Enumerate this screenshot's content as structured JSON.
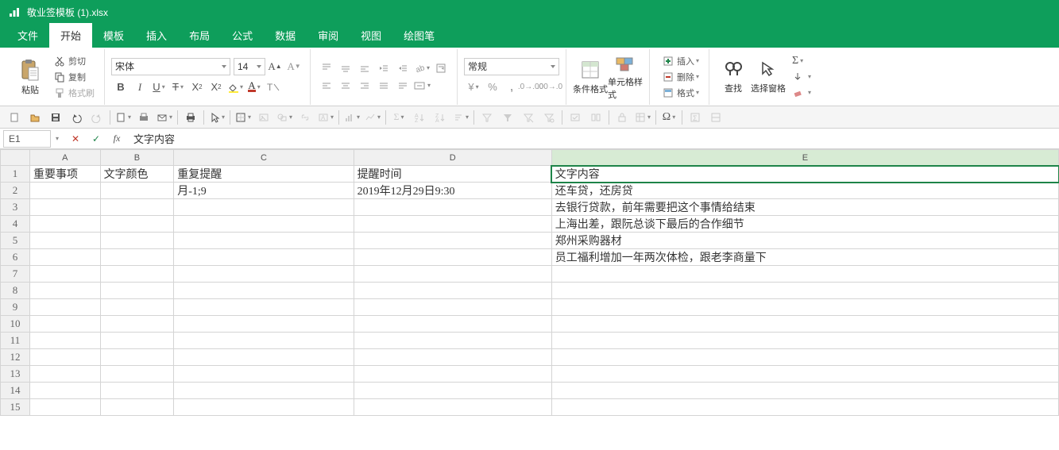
{
  "app": {
    "title": "敬业签模板 (1).xlsx"
  },
  "menu": {
    "items": [
      "文件",
      "开始",
      "模板",
      "插入",
      "布局",
      "公式",
      "数据",
      "审阅",
      "视图",
      "绘图笔"
    ],
    "active_index": 1
  },
  "ribbon": {
    "paste": "粘贴",
    "cut": "剪切",
    "copy": "复制",
    "format_painter": "格式刷",
    "font_name": "宋体",
    "font_size": "14",
    "number_format": "常规",
    "cond_format": "条件格式",
    "cell_style": "单元格样式",
    "insert": "插入",
    "delete": "删除",
    "format": "格式",
    "find": "查找",
    "select_pane": "选择窗格"
  },
  "formula_bar": {
    "name_box": "E1",
    "content": "文字内容"
  },
  "columns": [
    "A",
    "B",
    "C",
    "D",
    "E"
  ],
  "active_cell": {
    "row": 1,
    "col": "E"
  },
  "rows": [
    {
      "n": 1,
      "A": "重要事项",
      "B": "文字颜色",
      "C": "重复提醒",
      "D": "提醒时间",
      "E": "文字内容"
    },
    {
      "n": 2,
      "A": "",
      "B": "",
      "C": "月-1;9",
      "D": "2019年12月29日9:30",
      "E": "还车贷，还房贷"
    },
    {
      "n": 3,
      "A": "",
      "B": "",
      "C": "",
      "D": "",
      "E": "去银行贷款，前年需要把这个事情给结束"
    },
    {
      "n": 4,
      "A": "",
      "B": "",
      "C": "",
      "D": "",
      "E": "上海出差，跟阮总谈下最后的合作细节"
    },
    {
      "n": 5,
      "A": "",
      "B": "",
      "C": "",
      "D": "",
      "E": "郑州采购器材"
    },
    {
      "n": 6,
      "A": "",
      "B": "",
      "C": "",
      "D": "",
      "E": "员工福利增加一年两次体检，跟老李商量下"
    },
    {
      "n": 7,
      "A": "",
      "B": "",
      "C": "",
      "D": "",
      "E": ""
    },
    {
      "n": 8,
      "A": "",
      "B": "",
      "C": "",
      "D": "",
      "E": ""
    },
    {
      "n": 9,
      "A": "",
      "B": "",
      "C": "",
      "D": "",
      "E": ""
    },
    {
      "n": 10,
      "A": "",
      "B": "",
      "C": "",
      "D": "",
      "E": ""
    },
    {
      "n": 11,
      "A": "",
      "B": "",
      "C": "",
      "D": "",
      "E": ""
    },
    {
      "n": 12,
      "A": "",
      "B": "",
      "C": "",
      "D": "",
      "E": ""
    },
    {
      "n": 13,
      "A": "",
      "B": "",
      "C": "",
      "D": "",
      "E": ""
    },
    {
      "n": 14,
      "A": "",
      "B": "",
      "C": "",
      "D": "",
      "E": ""
    },
    {
      "n": 15,
      "A": "",
      "B": "",
      "C": "",
      "D": "",
      "E": ""
    }
  ]
}
